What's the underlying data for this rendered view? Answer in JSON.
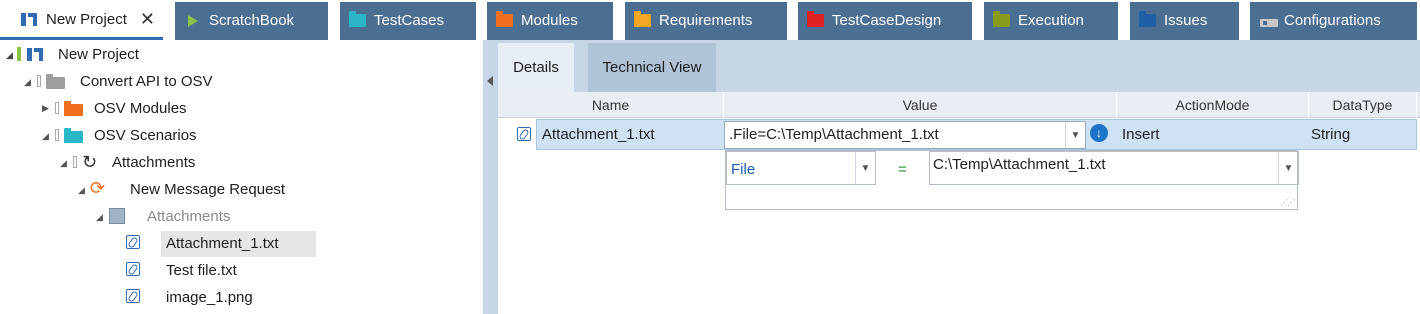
{
  "tabs": [
    {
      "label": "New Project",
      "icon": "project-icon",
      "active": true,
      "close": "✕"
    },
    {
      "label": "ScratchBook",
      "icon": "play-icon",
      "color": "#8bc34a"
    },
    {
      "label": "TestCases",
      "icon": "folder-icon",
      "color": "#29b6c6"
    },
    {
      "label": "Modules",
      "icon": "folder-icon",
      "color": "#f07020"
    },
    {
      "label": "Requirements",
      "icon": "folder-icon",
      "color": "#f5a623"
    },
    {
      "label": "TestCaseDesign",
      "icon": "folder-icon",
      "color": "#e02020"
    },
    {
      "label": "Execution",
      "icon": "folder-icon",
      "color": "#8a9a1a"
    },
    {
      "label": "Issues",
      "icon": "folder-icon",
      "color": "#1e5fa8"
    },
    {
      "label": "Configurations",
      "icon": "config-icon",
      "color": "#c8c8c8"
    }
  ],
  "tree": {
    "items": [
      {
        "label": "New Project",
        "icon": "project-icon"
      },
      {
        "label": "Convert API to OSV",
        "icon": "folder-icon"
      },
      {
        "label": "OSV Modules",
        "icon": "folder-icon"
      },
      {
        "label": "OSV Scenarios",
        "icon": "folder-icon"
      },
      {
        "label": "Attachments",
        "icon": "refresh-icon"
      },
      {
        "label": "New Message Request",
        "icon": "sync-icon"
      },
      {
        "label": "Attachments",
        "icon": "attachment-group-icon"
      },
      {
        "label": "Attachment_1.txt",
        "icon": "paperclip-icon",
        "selected": true
      },
      {
        "label": "Test file.txt",
        "icon": "paperclip-icon"
      },
      {
        "label": "image_1.png",
        "icon": "paperclip-icon"
      }
    ]
  },
  "details": {
    "tabs": [
      {
        "label": "Details",
        "active": true
      },
      {
        "label": "Technical View"
      }
    ],
    "columns": [
      "Name",
      "Value",
      "ActionMode",
      "DataType"
    ],
    "row": {
      "name": "Attachment_1.txt",
      "value": ".File=C:\\Temp\\Attachment_1.txt",
      "action_mode": "Insert",
      "data_type": "String"
    },
    "editor": {
      "key": "File",
      "operator": "=",
      "value": "C:\\Temp\\Attachment_1.txt"
    }
  },
  "colors": {
    "tab_bg": "#4a6f93",
    "accent": "#2f6ab3",
    "selected_row": "#cfe2f3",
    "pane_header": "#c6d6e6"
  }
}
